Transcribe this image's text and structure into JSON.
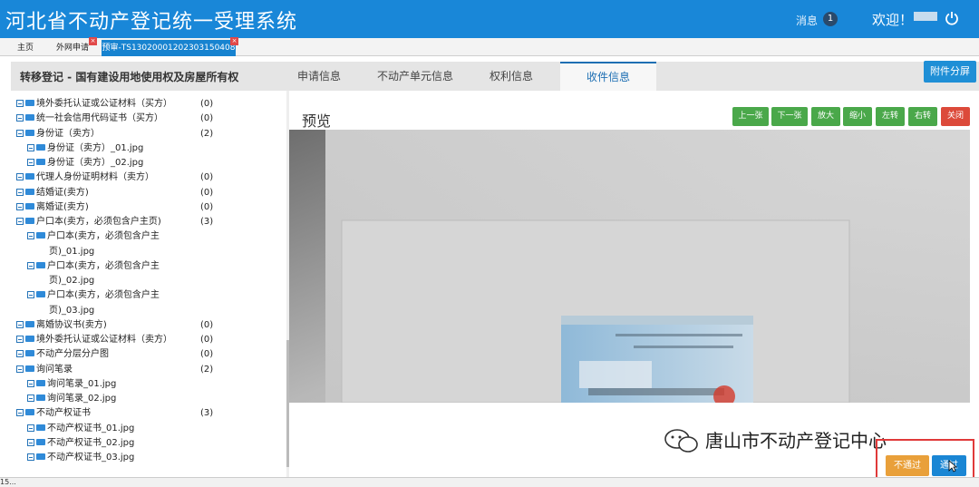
{
  "header": {
    "title": "河北省不动产登记统一受理系统",
    "message_label": "消息",
    "message_count": "1",
    "welcome": "欢迎！"
  },
  "tabs": [
    {
      "label": "主页"
    },
    {
      "label": "外网申请"
    },
    {
      "label": "预审-TS13020001202303150408"
    }
  ],
  "subheader": {
    "title": "转移登记 - 国有建设用地使用权及房屋所有权",
    "tabs": [
      "申请信息",
      "不动产单元信息",
      "权利信息",
      "收件信息"
    ],
    "active_tab": "收件信息",
    "split_button": "附件分屏"
  },
  "tree": {
    "items": [
      {
        "label": "境外委托认证或公证材料（买方）",
        "count": "(0)",
        "level": 0
      },
      {
        "label": "统一社会信用代码证书（买方）",
        "count": "(0)",
        "level": 0
      },
      {
        "label": "身份证（卖方）",
        "count": "(2)",
        "level": 0
      },
      {
        "label": "身份证（卖方）_01.jpg",
        "count": "",
        "level": 1
      },
      {
        "label": "身份证（卖方）_02.jpg",
        "count": "",
        "level": 1
      },
      {
        "label": "代理人身份证明材料（卖方）",
        "count": "(0)",
        "level": 0
      },
      {
        "label": "结婚证(卖方)",
        "count": "(0)",
        "level": 0
      },
      {
        "label": "离婚证(卖方)",
        "count": "(0)",
        "level": 0
      },
      {
        "label": "户口本(卖方，必须包含户主页)",
        "count": "(3)",
        "level": 0
      },
      {
        "label": "户口本(卖方，必须包含户主",
        "count": "",
        "level": 1
      },
      {
        "label": "页)_01.jpg",
        "count": "",
        "level": 2
      },
      {
        "label": "户口本(卖方，必须包含户主",
        "count": "",
        "level": 1
      },
      {
        "label": "页)_02.jpg",
        "count": "",
        "level": 2
      },
      {
        "label": "户口本(卖方，必须包含户主",
        "count": "",
        "level": 1
      },
      {
        "label": "页)_03.jpg",
        "count": "",
        "level": 2
      },
      {
        "label": "离婚协议书(卖方)",
        "count": "(0)",
        "level": 0
      },
      {
        "label": "境外委托认证或公证材料（卖方）",
        "count": "(0)",
        "level": 0
      },
      {
        "label": "不动产分层分户图",
        "count": "(0)",
        "level": 0
      },
      {
        "label": "询问笔录",
        "count": "(2)",
        "level": 0
      },
      {
        "label": "询问笔录_01.jpg",
        "count": "",
        "level": 1
      },
      {
        "label": "询问笔录_02.jpg",
        "count": "",
        "level": 1
      },
      {
        "label": "不动产权证书",
        "count": "(3)",
        "level": 0
      },
      {
        "label": "不动产权证书_01.jpg",
        "count": "",
        "level": 1
      },
      {
        "label": "不动产权证书_02.jpg",
        "count": "",
        "level": 1
      },
      {
        "label": "不动产权证书_03.jpg",
        "count": "",
        "level": 1
      }
    ]
  },
  "preview": {
    "title": "预览",
    "toolbar": [
      "上一张",
      "下一张",
      "放大",
      "缩小",
      "左转",
      "右转",
      "关闭"
    ]
  },
  "watermark": "唐山市不动产登记中心",
  "actions": {
    "reject": "不通过",
    "approve": "通过"
  },
  "statusbar": "15..."
}
